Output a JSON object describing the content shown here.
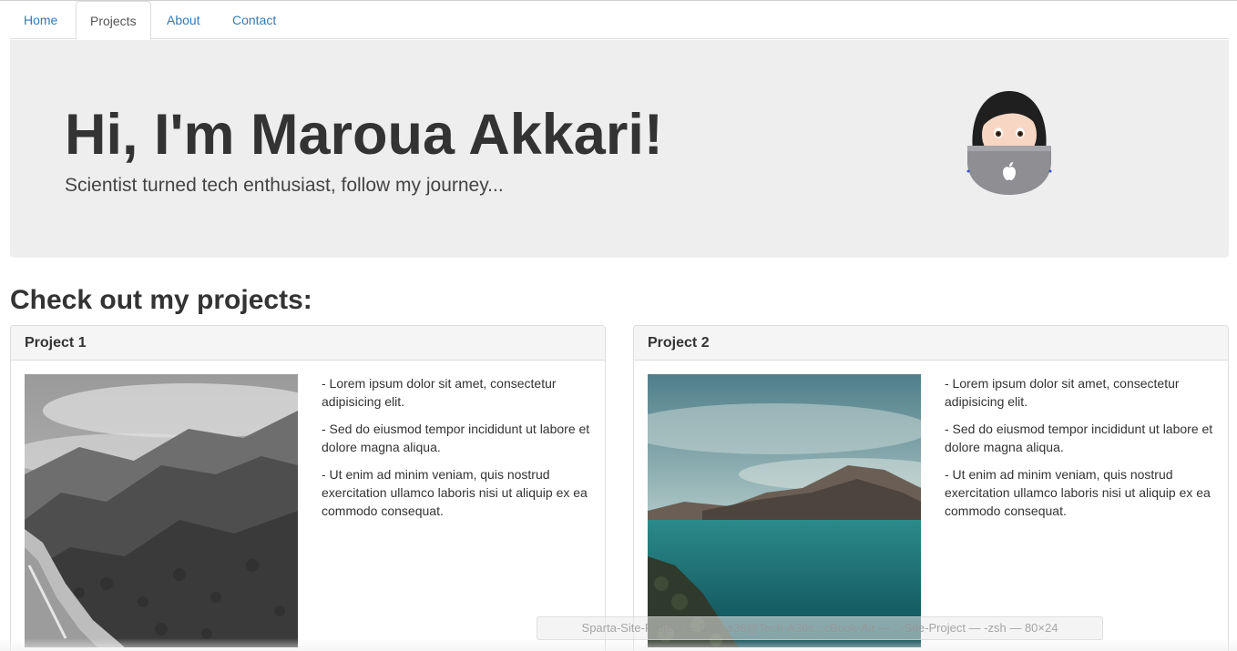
{
  "nav": {
    "tabs": [
      {
        "label": "Home"
      },
      {
        "label": "Projects"
      },
      {
        "label": "About"
      },
      {
        "label": "Contact"
      }
    ],
    "active": "Projects"
  },
  "hero": {
    "title": "Hi, I'm Maroua Akkari!",
    "subtitle": "Scientist turned tech enthusiast, follow my journey...",
    "avatar_icon": "woman-technologist-laptop-icon"
  },
  "projects": {
    "heading": "Check out my projects:",
    "items": [
      {
        "title": "Project 1",
        "image_icon": "forest-mountain-bw-photo",
        "bullets": [
          "- Lorem ipsum dolor sit amet, consectetur adipisicing elit.",
          "- Sed do eiusmod tempor incididunt ut labore et dolore magna aliqua.",
          "- Ut enim ad minim veniam, quis nostrud exercitation ullamco laboris nisi ut aliquip ex ea commodo consequat."
        ]
      },
      {
        "title": "Project 2",
        "image_icon": "lake-mountain-photo",
        "bullets": [
          "- Lorem ipsum dolor sit amet, consectetur adipisicing elit.",
          "- Sed do eiusmod tempor incididunt ut labore et dolore magna aliqua.",
          "- Ut enim ad minim veniam, quis nostrud exercitation ullamco laboris nisi ut aliquip ex ea commodo consequat."
        ]
      }
    ]
  },
  "terminal": {
    "title": "Sparta-Site-Project — tech-a36@Tech-A36s...cBook-Air — ..-Site-Project — -zsh — 80×24"
  },
  "colors": {
    "link": "#337ab7",
    "jumbotron_bg": "#eeeeee",
    "panel_heading_bg": "#f5f5f5",
    "border": "#dddddd"
  }
}
